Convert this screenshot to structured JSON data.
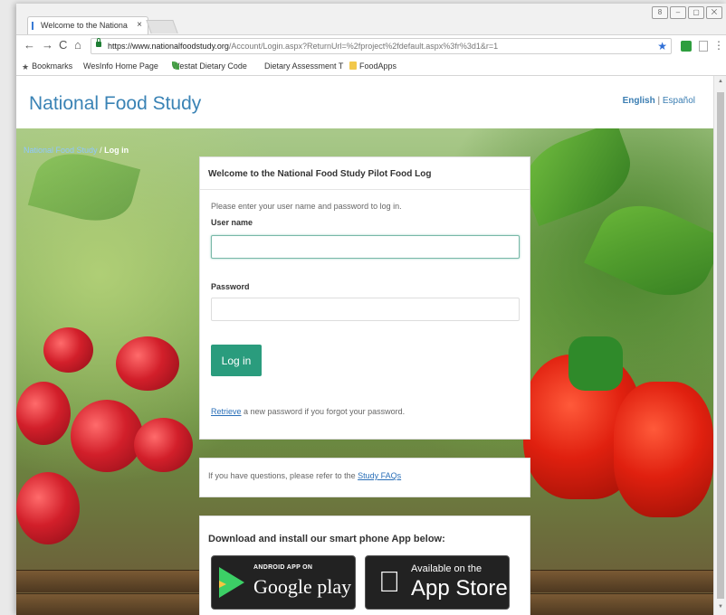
{
  "browser": {
    "tab_title": "Welcome to the Nationa",
    "tab_close": "×",
    "window_controls": [
      "8",
      "–",
      "▢",
      "⨉"
    ],
    "url_host": "https://www.nationalfoodstudy.org",
    "url_path": "/Account/Login.aspx?ReturnUrl=%2fproject%2fdefault.aspx%3fr%3d1&r=1",
    "bookmarks": [
      {
        "label": "Bookmarks",
        "icon": "star-icon"
      },
      {
        "label": "WesInfo Home Page",
        "icon": "page-icon"
      },
      {
        "label": "Westat Dietary Code",
        "icon": "leaf-icon"
      },
      {
        "label": "Dietary Assessment T",
        "icon": "page-icon"
      },
      {
        "label": "FoodApps",
        "icon": "folder-icon"
      }
    ]
  },
  "site": {
    "brand": "National Food Study",
    "lang_english": "English",
    "lang_sep": "|",
    "lang_spanish": "Español",
    "breadcrumb_home": "National Food Study",
    "breadcrumb_sep": " / ",
    "breadcrumb_current": "Log in"
  },
  "login": {
    "heading": "Welcome to the National Food Study Pilot Food Log",
    "instructions": "Please enter your user name and password to log in.",
    "username_label": "User name",
    "username_value": "",
    "password_label": "Password",
    "password_value": "",
    "button": "Log in",
    "retrieve_link": "Retrieve",
    "retrieve_text": " a new password if you forgot your password."
  },
  "faq": {
    "text": "If you have questions, please refer to the ",
    "link": "Study FAQs"
  },
  "apps": {
    "title": "Download and install our smart phone App below:",
    "google_small": "ANDROID APP ON",
    "google_big": "Google play",
    "apple_small": "Available on the",
    "apple_big": "App Store"
  },
  "colors": {
    "brand": "#3a83b5",
    "button": "#2a9c7d",
    "link": "#2a6fb8"
  }
}
